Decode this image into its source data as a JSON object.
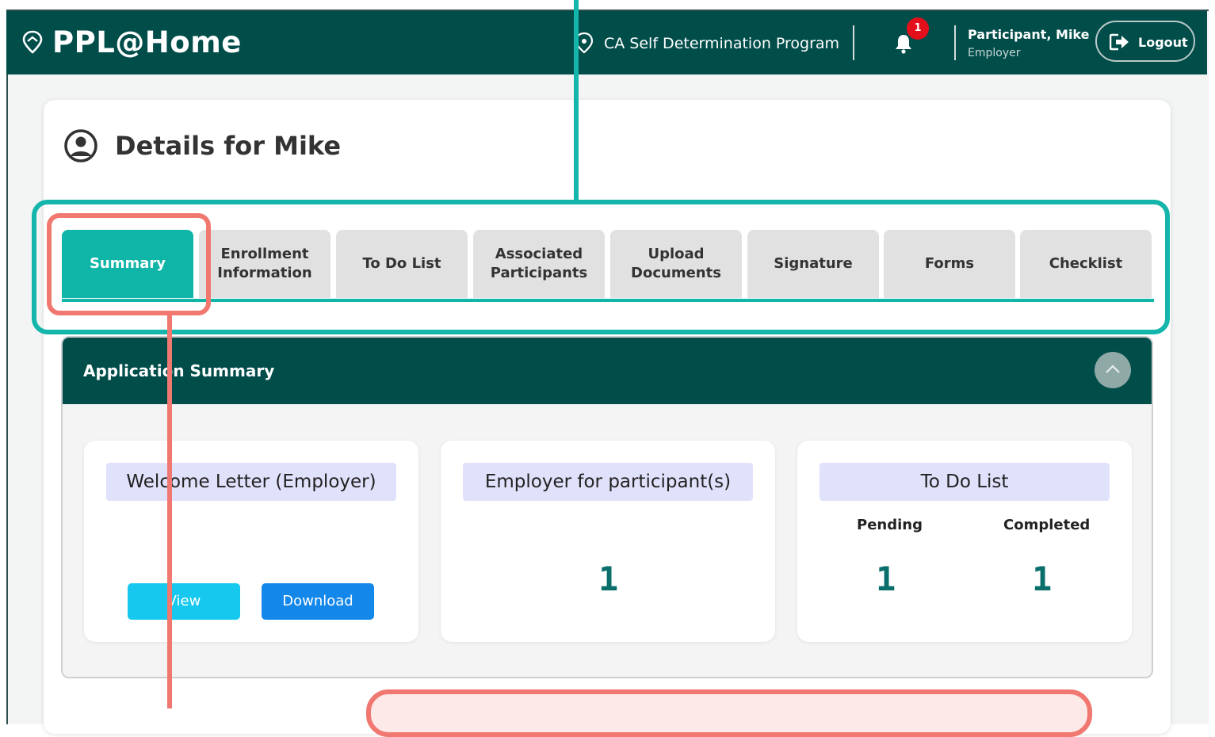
{
  "header": {
    "brand": "PPL@Home",
    "program": "CA Self Determination Program",
    "notification_count": "1",
    "user_name": "Participant, Mike",
    "user_role": "Employer",
    "logout_label": "Logout"
  },
  "page": {
    "title": "Details for Mike"
  },
  "tabs": [
    {
      "label": "Summary",
      "active": true
    },
    {
      "label": "Enrollment Information",
      "active": false
    },
    {
      "label": "To Do List",
      "active": false
    },
    {
      "label": "Associated Participants",
      "active": false
    },
    {
      "label": "Upload Documents",
      "active": false
    },
    {
      "label": "Signature",
      "active": false
    },
    {
      "label": "Forms",
      "active": false
    },
    {
      "label": "Checklist",
      "active": false
    }
  ],
  "summary": {
    "title": "Application Summary",
    "welcome": {
      "title": "Welcome Letter (Employer)",
      "view_label": "View",
      "download_label": "Download"
    },
    "employer_for": {
      "title": "Employer for participant(s)",
      "value": "1"
    },
    "todo": {
      "title": "To Do List",
      "pending_label": "Pending",
      "pending_value": "1",
      "completed_label": "Completed",
      "completed_value": "1"
    }
  },
  "colors": {
    "header_bg": "#004d4a",
    "accent_teal": "#0fb5a7",
    "annotation_teal": "#14b5aa",
    "annotation_red": "#f07870",
    "view_button": "#16c8ee",
    "download_button": "#1387ea",
    "card_header": "#e0e1fb"
  }
}
